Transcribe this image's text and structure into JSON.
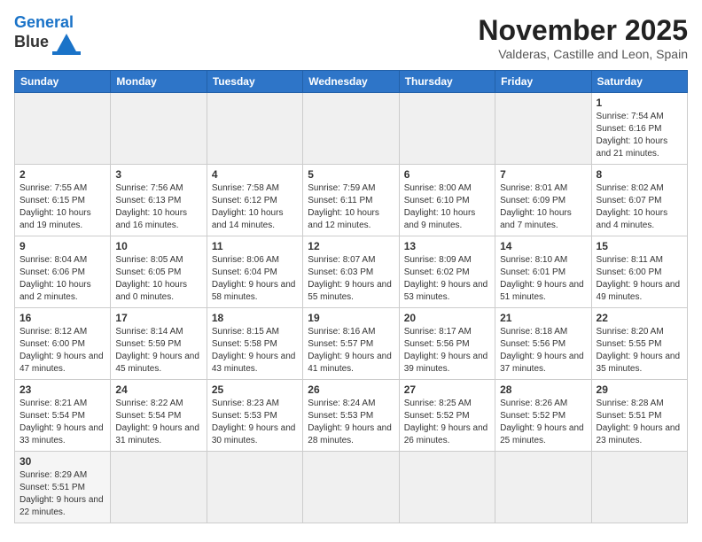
{
  "header": {
    "logo_line1": "General",
    "logo_line2": "Blue",
    "month": "November 2025",
    "location": "Valderas, Castille and Leon, Spain"
  },
  "days_of_week": [
    "Sunday",
    "Monday",
    "Tuesday",
    "Wednesday",
    "Thursday",
    "Friday",
    "Saturday"
  ],
  "weeks": [
    [
      {
        "day": "",
        "empty": true
      },
      {
        "day": "",
        "empty": true
      },
      {
        "day": "",
        "empty": true
      },
      {
        "day": "",
        "empty": true
      },
      {
        "day": "",
        "empty": true
      },
      {
        "day": "",
        "empty": true
      },
      {
        "day": "1",
        "info": "Sunrise: 7:54 AM\nSunset: 6:16 PM\nDaylight: 10 hours and 21 minutes."
      }
    ],
    [
      {
        "day": "2",
        "info": "Sunrise: 7:55 AM\nSunset: 6:15 PM\nDaylight: 10 hours and 19 minutes."
      },
      {
        "day": "3",
        "info": "Sunrise: 7:56 AM\nSunset: 6:13 PM\nDaylight: 10 hours and 16 minutes."
      },
      {
        "day": "4",
        "info": "Sunrise: 7:58 AM\nSunset: 6:12 PM\nDaylight: 10 hours and 14 minutes."
      },
      {
        "day": "5",
        "info": "Sunrise: 7:59 AM\nSunset: 6:11 PM\nDaylight: 10 hours and 12 minutes."
      },
      {
        "day": "6",
        "info": "Sunrise: 8:00 AM\nSunset: 6:10 PM\nDaylight: 10 hours and 9 minutes."
      },
      {
        "day": "7",
        "info": "Sunrise: 8:01 AM\nSunset: 6:09 PM\nDaylight: 10 hours and 7 minutes."
      },
      {
        "day": "8",
        "info": "Sunrise: 8:02 AM\nSunset: 6:07 PM\nDaylight: 10 hours and 4 minutes."
      }
    ],
    [
      {
        "day": "9",
        "info": "Sunrise: 8:04 AM\nSunset: 6:06 PM\nDaylight: 10 hours and 2 minutes."
      },
      {
        "day": "10",
        "info": "Sunrise: 8:05 AM\nSunset: 6:05 PM\nDaylight: 10 hours and 0 minutes."
      },
      {
        "day": "11",
        "info": "Sunrise: 8:06 AM\nSunset: 6:04 PM\nDaylight: 9 hours and 58 minutes."
      },
      {
        "day": "12",
        "info": "Sunrise: 8:07 AM\nSunset: 6:03 PM\nDaylight: 9 hours and 55 minutes."
      },
      {
        "day": "13",
        "info": "Sunrise: 8:09 AM\nSunset: 6:02 PM\nDaylight: 9 hours and 53 minutes."
      },
      {
        "day": "14",
        "info": "Sunrise: 8:10 AM\nSunset: 6:01 PM\nDaylight: 9 hours and 51 minutes."
      },
      {
        "day": "15",
        "info": "Sunrise: 8:11 AM\nSunset: 6:00 PM\nDaylight: 9 hours and 49 minutes."
      }
    ],
    [
      {
        "day": "16",
        "info": "Sunrise: 8:12 AM\nSunset: 6:00 PM\nDaylight: 9 hours and 47 minutes."
      },
      {
        "day": "17",
        "info": "Sunrise: 8:14 AM\nSunset: 5:59 PM\nDaylight: 9 hours and 45 minutes."
      },
      {
        "day": "18",
        "info": "Sunrise: 8:15 AM\nSunset: 5:58 PM\nDaylight: 9 hours and 43 minutes."
      },
      {
        "day": "19",
        "info": "Sunrise: 8:16 AM\nSunset: 5:57 PM\nDaylight: 9 hours and 41 minutes."
      },
      {
        "day": "20",
        "info": "Sunrise: 8:17 AM\nSunset: 5:56 PM\nDaylight: 9 hours and 39 minutes."
      },
      {
        "day": "21",
        "info": "Sunrise: 8:18 AM\nSunset: 5:56 PM\nDaylight: 9 hours and 37 minutes."
      },
      {
        "day": "22",
        "info": "Sunrise: 8:20 AM\nSunset: 5:55 PM\nDaylight: 9 hours and 35 minutes."
      }
    ],
    [
      {
        "day": "23",
        "info": "Sunrise: 8:21 AM\nSunset: 5:54 PM\nDaylight: 9 hours and 33 minutes."
      },
      {
        "day": "24",
        "info": "Sunrise: 8:22 AM\nSunset: 5:54 PM\nDaylight: 9 hours and 31 minutes."
      },
      {
        "day": "25",
        "info": "Sunrise: 8:23 AM\nSunset: 5:53 PM\nDaylight: 9 hours and 30 minutes."
      },
      {
        "day": "26",
        "info": "Sunrise: 8:24 AM\nSunset: 5:53 PM\nDaylight: 9 hours and 28 minutes."
      },
      {
        "day": "27",
        "info": "Sunrise: 8:25 AM\nSunset: 5:52 PM\nDaylight: 9 hours and 26 minutes."
      },
      {
        "day": "28",
        "info": "Sunrise: 8:26 AM\nSunset: 5:52 PM\nDaylight: 9 hours and 25 minutes."
      },
      {
        "day": "29",
        "info": "Sunrise: 8:28 AM\nSunset: 5:51 PM\nDaylight: 9 hours and 23 minutes."
      }
    ],
    [
      {
        "day": "30",
        "info": "Sunrise: 8:29 AM\nSunset: 5:51 PM\nDaylight: 9 hours and 22 minutes."
      },
      {
        "day": "",
        "empty": true
      },
      {
        "day": "",
        "empty": true
      },
      {
        "day": "",
        "empty": true
      },
      {
        "day": "",
        "empty": true
      },
      {
        "day": "",
        "empty": true
      },
      {
        "day": "",
        "empty": true
      }
    ]
  ]
}
